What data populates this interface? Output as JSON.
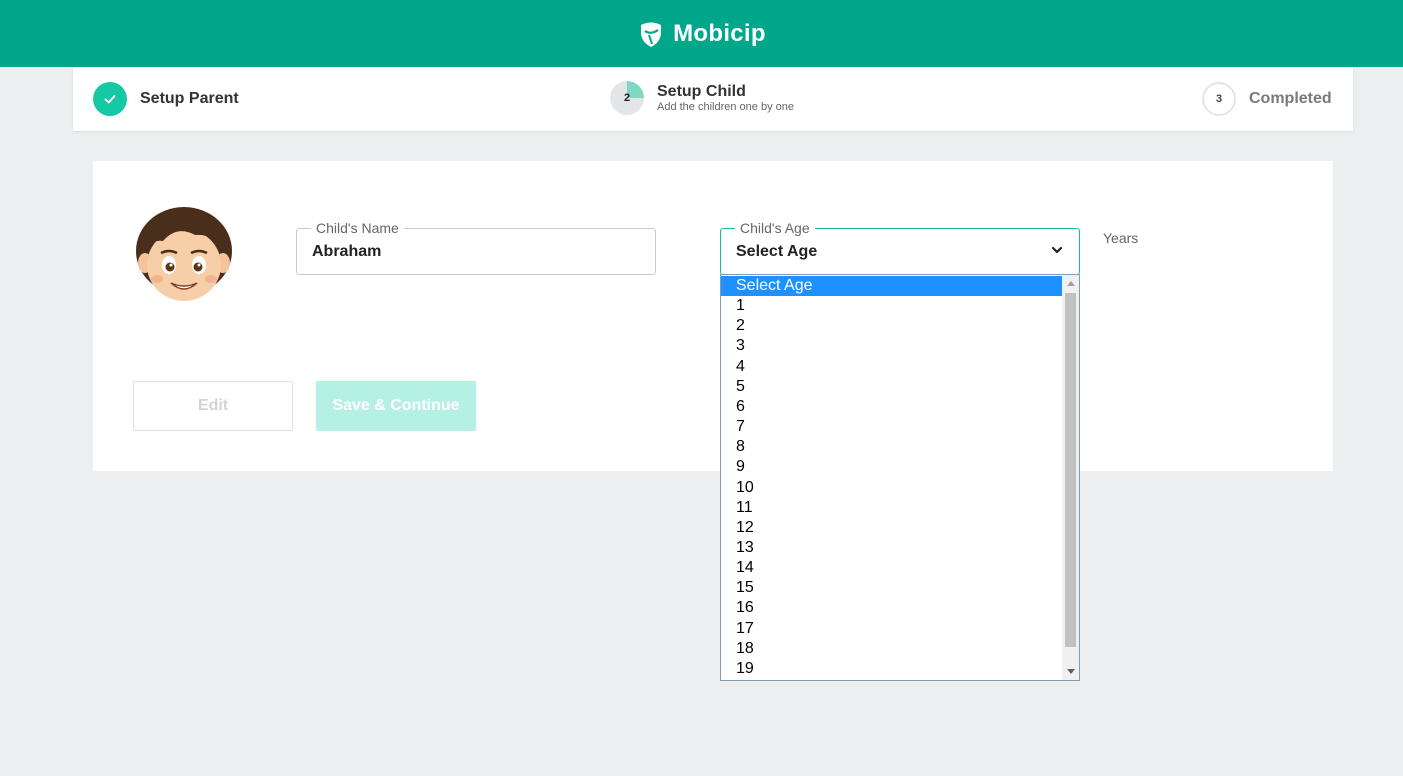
{
  "header": {
    "brand": "Mobicip",
    "logo_icon": "mobicip-shield-logo-icon"
  },
  "stepper": {
    "steps": [
      {
        "number": "✓",
        "title": "Setup Parent",
        "status": "completed"
      },
      {
        "number": "2",
        "title": "Setup Child",
        "subtitle": "Add the children one by one",
        "status": "active"
      },
      {
        "number": "3",
        "title": "Completed",
        "status": "pending"
      }
    ]
  },
  "form": {
    "name_label": "Child's Name",
    "name_value": "Abraham",
    "age_label": "Child's Age",
    "age_value": "Select Age",
    "age_unit": "Years"
  },
  "buttons": {
    "edit": "Edit",
    "save": "Save & Continue"
  },
  "age_dropdown": {
    "options": [
      "Select Age",
      "1",
      "2",
      "3",
      "4",
      "5",
      "6",
      "7",
      "8",
      "9",
      "10",
      "11",
      "12",
      "13",
      "14",
      "15",
      "16",
      "17",
      "18",
      "19"
    ],
    "highlighted": "Select Age"
  },
  "colors": {
    "brand": "#00a78a",
    "step_done": "#14c9a4",
    "save_disabled": "#b5f0e4",
    "option_highlight": "#1e90ff"
  }
}
